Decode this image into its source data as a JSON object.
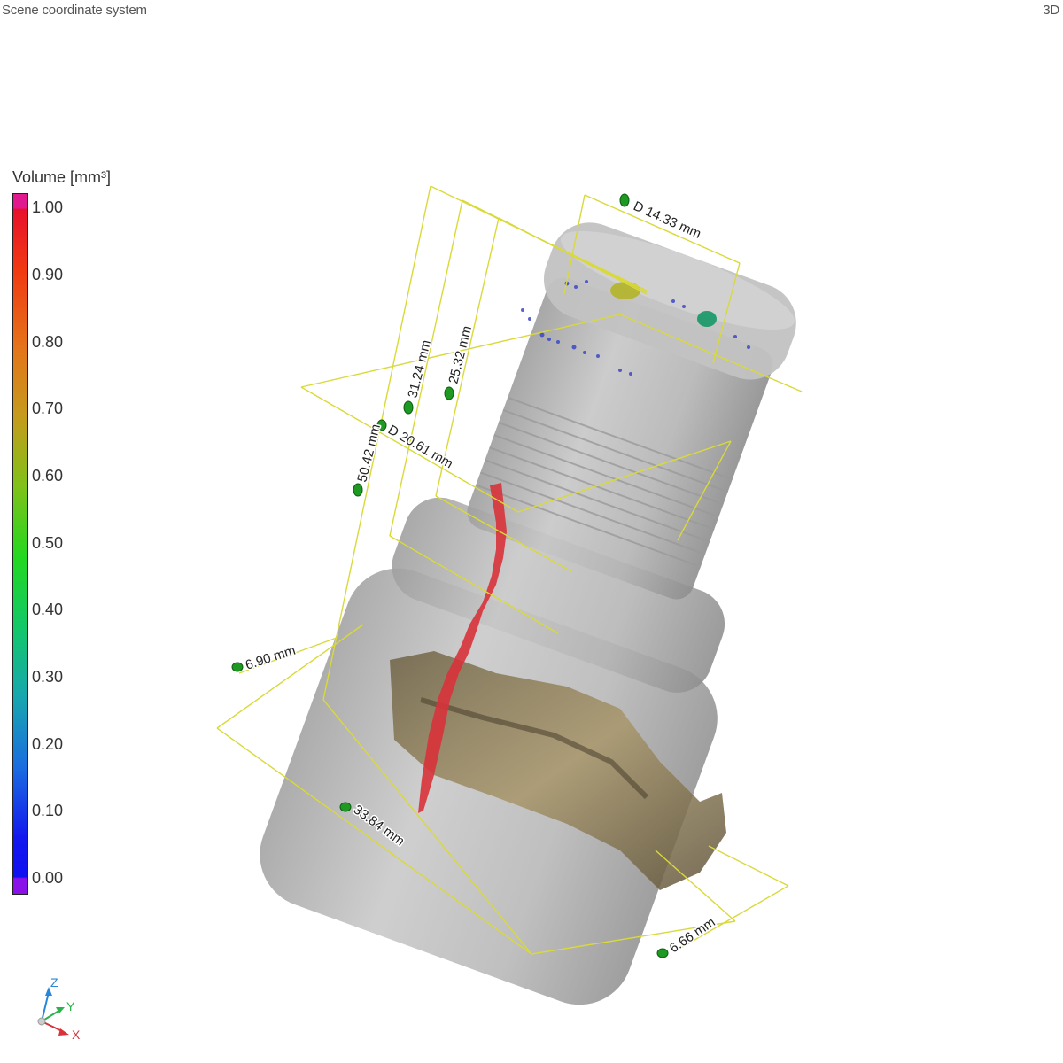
{
  "viewport": {
    "title": "Scene coordinate system",
    "mode": "3D"
  },
  "legend": {
    "title": "Volume [mm³]",
    "ticks": [
      "1.00",
      "0.90",
      "0.80",
      "0.70",
      "0.60",
      "0.50",
      "0.40",
      "0.30",
      "0.20",
      "0.10",
      "0.00"
    ]
  },
  "measurements": {
    "diameter_top": "D 14.33 mm",
    "diameter_thread": "D 20.61 mm",
    "height_31": "31.24 mm",
    "height_25": "25.32 mm",
    "height_50": "50.42 mm",
    "width_6_90": "6.90 mm",
    "width_33": "33.84 mm",
    "width_6_66": "6.66 mm"
  },
  "axes": {
    "z": "Z",
    "y": "Y",
    "x": "X"
  },
  "colors": {
    "measure_line": "#d9d93a",
    "marker_green": "#1e9a22",
    "defect_red": "#d8323a",
    "part_gray": "#b9b9b9",
    "clip_metal": "#8c7a52"
  }
}
